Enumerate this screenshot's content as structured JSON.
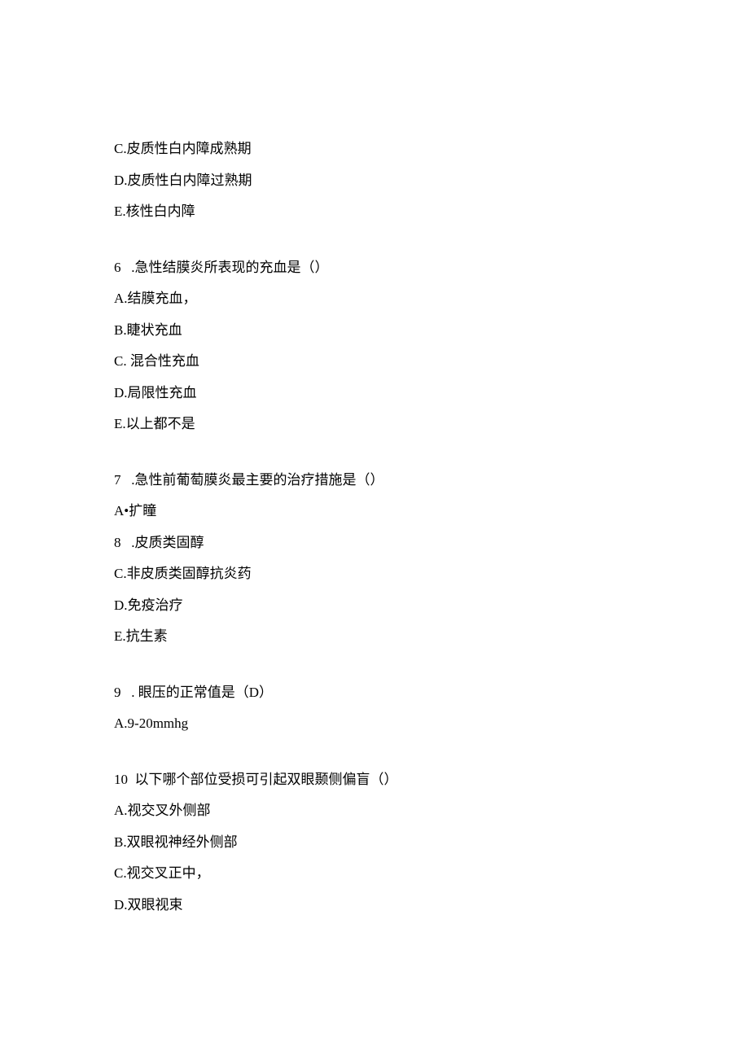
{
  "q5": {
    "c": "C.皮质性白内障成熟期",
    "d": "D.皮质性白内障过熟期",
    "e": "E.核性白内障"
  },
  "q6": {
    "stem": "6   .急性结膜炎所表现的充血是（）",
    "a": "A.结膜充血，",
    "b": "B.睫状充血",
    "c": "C. 混合性充血",
    "d": "D.局限性充血",
    "e": "E.以上都不是"
  },
  "q7": {
    "stem": "7   .急性前葡萄膜炎最主要的治疗措施是（）",
    "a": "A•扩瞳",
    "b": "8   .皮质类固醇",
    "c": "C.非皮质类固醇抗炎药",
    "d": "D.免疫治疗",
    "e": "E.抗生素"
  },
  "q9": {
    "stem": "9   . 眼压的正常值是（D）",
    "a": "A.9-20mmhg"
  },
  "q10": {
    "stem": "10  以下哪个部位受损可引起双眼颞侧偏盲（）",
    "a": "A.视交叉外侧部",
    "b": "B.双眼视神经外侧部",
    "c": "C.视交叉正中，",
    "d": "D.双眼视束"
  }
}
